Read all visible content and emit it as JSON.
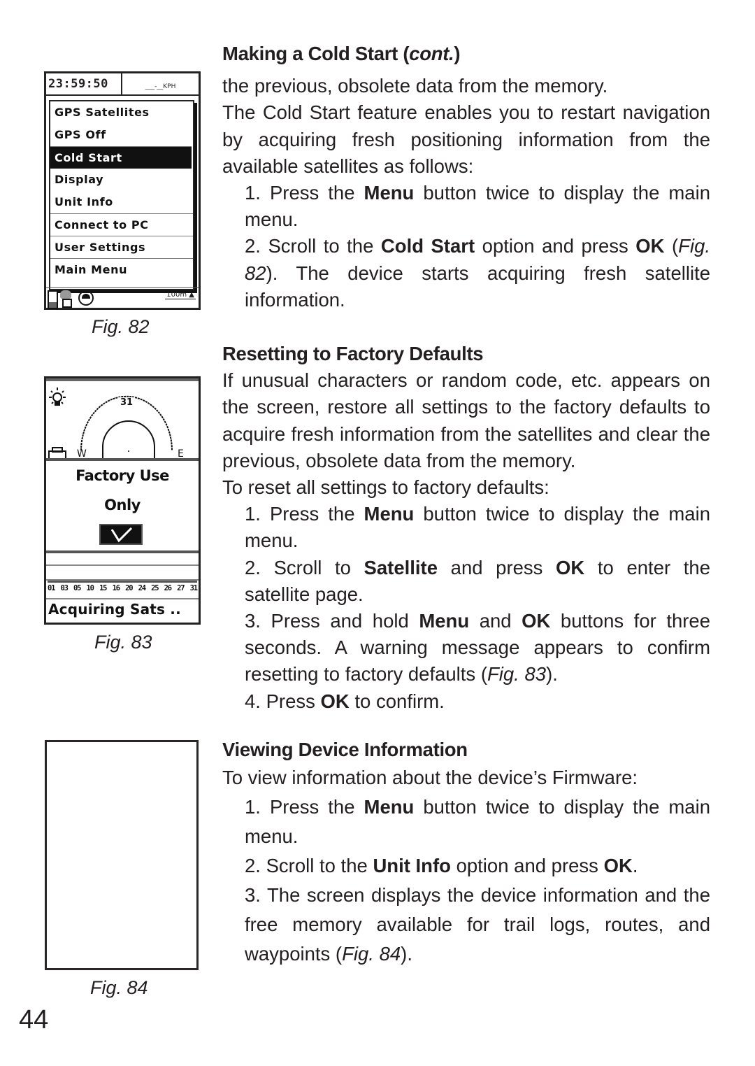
{
  "figures": {
    "fig82": {
      "caption": "Fig. 82",
      "time": "23:59:50",
      "speed_readout": "___-__KPH",
      "menu_items": [
        {
          "label": "GPS Satellites",
          "selected": false
        },
        {
          "label": "GPS Off",
          "selected": false
        },
        {
          "label": "Cold Start",
          "selected": true
        },
        {
          "label": "Display",
          "selected": false
        },
        {
          "label": "Unit Info",
          "selected": false
        },
        {
          "label": "Connect to PC",
          "selected": false
        },
        {
          "label": "User Settings",
          "selected": false
        },
        {
          "label": "Main Menu",
          "selected": false
        }
      ],
      "scale_label": "100m",
      "status_icons": [
        "battery-icon",
        "signal-icon",
        "compass-icon",
        "north-arrow-icon"
      ]
    },
    "fig83": {
      "caption": "Fig. 83",
      "sky_satellite": "31",
      "west_label": "W",
      "east_label": "E",
      "dialog_line1": "Factory Use",
      "dialog_line2": "Only",
      "confirm_icon": "checkmark-icon",
      "satellite_numbers": [
        "01",
        "03",
        "05",
        "10",
        "15",
        "16",
        "20",
        "24",
        "25",
        "26",
        "27",
        "31"
      ],
      "status_text": "Acquiring Sats .."
    },
    "fig84": {
      "caption": "Fig. 84"
    }
  },
  "sections": {
    "cold_start": {
      "heading": "Making a Cold Start",
      "heading_suffix": "cont.",
      "para1": "the previous, obsolete data from the memory.",
      "para2": "The Cold Start feature enables you to restart navigation by acquiring fresh positioning information from the available satellites as follows:",
      "steps": [
        {
          "n": "1.",
          "pre": "Press the ",
          "bold": "Menu",
          "post": " button twice to display the main menu."
        },
        {
          "n": "2.",
          "pre": "Scroll to the ",
          "bold": "Cold Start",
          "mid": " option and press ",
          "bold2": "OK",
          "fig_open": " (",
          "fig": "Fig. 82",
          "post": "). The device starts acquiring fresh satellite information."
        }
      ]
    },
    "factory_reset": {
      "heading": "Resetting to Factory Defaults",
      "para1": "If unusual characters or random code, etc. appears on the screen, restore all settings to the factory defaults to acquire fresh information from the satellites and clear the previous, obsolete data from the memory.",
      "para2": "To reset all settings to factory defaults:",
      "steps": [
        {
          "n": "1.",
          "pre": "Press the ",
          "bold": "Menu",
          "post": " button twice to display the main menu."
        },
        {
          "n": "2.",
          "pre": "Scroll to ",
          "bold": "Satellite",
          "mid": " and press ",
          "bold2": "OK",
          "post": " to enter the satellite page."
        },
        {
          "n": "3.",
          "pre": "Press and hold ",
          "bold": "Menu",
          "mid": " and ",
          "bold2": "OK",
          "post": " buttons for three seconds. A warning message appears to confirm resetting to factory defaults (",
          "fig": "Fig. 83",
          "post2": ")."
        },
        {
          "n": "4.",
          "pre": "Press ",
          "bold": "OK",
          "post": " to confirm."
        }
      ]
    },
    "device_info": {
      "heading": "Viewing Device Information",
      "para1": "To view information about the device’s Firmware:",
      "steps": [
        {
          "n": "1.",
          "pre": "Press the ",
          "bold": "Menu",
          "post": " button twice to display the main menu."
        },
        {
          "n": "2.",
          "pre": "Scroll to the ",
          "bold": "Unit Info",
          "mid": " option and press ",
          "bold2": "OK",
          "post": "."
        },
        {
          "n": "3.",
          "pre": "The screen displays the device information and the free memory available for trail logs, routes, and waypoints (",
          "fig": "Fig. 84",
          "post": ")."
        }
      ]
    }
  },
  "page_number": "44"
}
